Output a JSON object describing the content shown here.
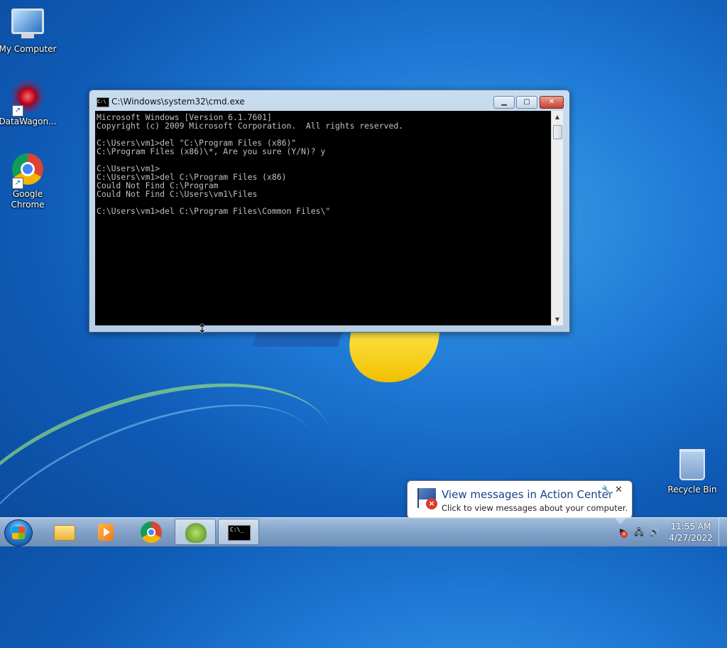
{
  "desktop": {
    "icons": [
      {
        "label": "My Computer",
        "icon": "computer-icon"
      },
      {
        "label": "DataWagon...",
        "icon": "datawagon-icon"
      },
      {
        "label": "Google Chrome",
        "icon": "chrome-icon"
      },
      {
        "label": "Recycle Bin",
        "icon": "recycle-bin-icon"
      }
    ]
  },
  "cmd_window": {
    "title": "C:\\Windows\\system32\\cmd.exe",
    "icon_label": "C:\\",
    "lines": [
      "Microsoft Windows [Version 6.1.7601]",
      "Copyright (c) 2009 Microsoft Corporation.  All rights reserved.",
      "",
      "C:\\Users\\vm1>del \"C:\\Program Files (x86)\"",
      "C:\\Program Files (x86)\\*, Are you sure (Y/N)? y",
      "",
      "C:\\Users\\vm1>",
      "C:\\Users\\vm1>del C:\\Program Files (x86)",
      "Could Not Find C:\\Program",
      "Could Not Find C:\\Users\\vm1\\Files",
      "",
      "C:\\Users\\vm1>del C:\\Program Files\\Common Files\\\""
    ]
  },
  "notification": {
    "title": "View messages in Action Center",
    "message": "Click to view messages about your computer."
  },
  "taskbar": {
    "pinned": [
      "start-button",
      "windows-explorer",
      "windows-media-player",
      "google-chrome",
      "datawagon-app",
      "command-prompt"
    ],
    "cmd_label": "C:\\_",
    "clock": {
      "time": "11:55 AM",
      "date": "4/27/2022"
    }
  },
  "colors": {
    "console_background": "#000000",
    "console_text": "#C0C0C0",
    "close_button": "#C7402C",
    "notification_title": "#1A3E8A"
  }
}
